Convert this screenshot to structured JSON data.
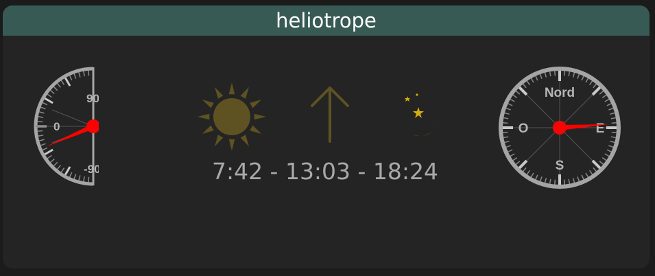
{
  "card": {
    "title": "heliotrope"
  },
  "elevation_gauge": {
    "labels": {
      "top": "90",
      "middle": "0",
      "bottom": "-90"
    },
    "needle_degrees": -18,
    "needle_color": "#ff0000"
  },
  "compass": {
    "labels": {
      "north": "Nord",
      "east": "E",
      "south": "S",
      "west": "O"
    },
    "needle_degrees": 86,
    "needle_color": "#ff0000"
  },
  "icons": {
    "sun": "sun-icon",
    "direction": "arrow-up-icon",
    "moon": "moon-stars-icon",
    "sun_color": "#5e5222",
    "moon_color": "#d4b006"
  },
  "sun_times": {
    "text": "7:42 - 13:03 - 18:24"
  },
  "colors": {
    "header": "#385a55",
    "card": "#242424",
    "gauge_rim": "#a5a5a5"
  }
}
